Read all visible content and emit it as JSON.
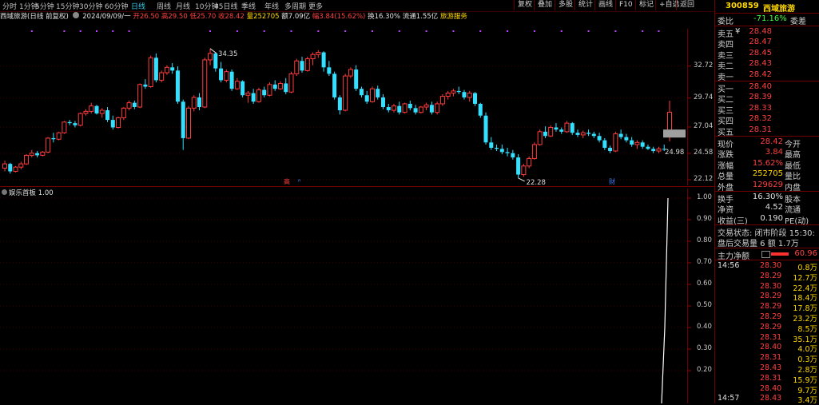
{
  "toolbar": {
    "timeframes": [
      "分时",
      "1分钟",
      "5分钟",
      "15分钟",
      "30分钟",
      "60分钟",
      "日线",
      "周线",
      "月线",
      "10分钟",
      "45日线",
      "季线",
      "年线",
      "多周期",
      "更多"
    ],
    "active_timeframe": "日线",
    "buttons": [
      "复权",
      "叠加",
      "多股",
      "统计",
      "画线",
      "F10",
      "标记",
      "+自选",
      "返回"
    ]
  },
  "header": {
    "stock_title": "西域旅游(日线 前复权)",
    "date": "2024/09/09/一",
    "open_label": "开",
    "open": "26.50",
    "high_label": "高",
    "high": "29.50",
    "low_label": "低",
    "low": "25.70",
    "close_label": "收",
    "close": "28.42",
    "volume_label": "量",
    "volume": "252705",
    "amount_label": "额",
    "amount": "7.09亿",
    "change_label": "幅",
    "change": "3.84(15.62%)",
    "turnover_label": "换",
    "turnover": "16.30%",
    "float_label": "流通",
    "float": "1.55亿",
    "sector": "旅游服务"
  },
  "kline": {
    "y_ticks": [
      "32.72",
      "29.74",
      "27.04",
      "24.58",
      "22.12"
    ],
    "high_marker": "34.35",
    "low_marker": "22.28",
    "last_marker": "24.98",
    "bottom_marks": [
      "高",
      "ᴿ",
      "财"
    ]
  },
  "indicator": {
    "title": "娱乐首板",
    "value": "1.00",
    "y_ticks": [
      "1.00",
      "0.90",
      "0.80",
      "0.70",
      "0.60",
      "0.50",
      "0.40",
      "0.30",
      "0.20"
    ]
  },
  "chart_data": {
    "type": "candlestick",
    "ylim": [
      21.6,
      36.2
    ],
    "candles": [
      [
        23.2,
        23.9,
        22.9,
        23.6
      ],
      [
        23.6,
        23.7,
        22.7,
        22.9
      ],
      [
        22.9,
        23.4,
        22.8,
        23.3
      ],
      [
        23.3,
        23.8,
        23.1,
        23.6
      ],
      [
        23.6,
        24.5,
        23.5,
        24.4
      ],
      [
        24.4,
        24.9,
        24.2,
        24.6
      ],
      [
        24.6,
        24.8,
        24.2,
        24.4
      ],
      [
        24.4,
        24.8,
        24.3,
        24.7
      ],
      [
        24.7,
        26.1,
        24.6,
        26.0
      ],
      [
        26.0,
        26.5,
        25.6,
        25.9
      ],
      [
        25.9,
        26.6,
        25.8,
        26.5
      ],
      [
        26.5,
        27.6,
        26.4,
        27.5
      ],
      [
        27.5,
        27.7,
        27.2,
        27.4
      ],
      [
        27.4,
        27.6,
        27.0,
        27.2
      ],
      [
        27.2,
        28.4,
        27.1,
        28.3
      ],
      [
        28.3,
        28.7,
        28.1,
        28.5
      ],
      [
        28.5,
        29.3,
        28.3,
        29.0
      ],
      [
        29.0,
        29.1,
        28.2,
        28.3
      ],
      [
        28.3,
        28.8,
        27.9,
        28.6
      ],
      [
        28.6,
        28.9,
        27.5,
        27.7
      ],
      [
        27.7,
        28.1,
        26.8,
        27.0
      ],
      [
        27.0,
        28.0,
        26.9,
        27.9
      ],
      [
        27.9,
        28.9,
        27.7,
        28.8
      ],
      [
        28.8,
        29.5,
        28.6,
        29.3
      ],
      [
        29.3,
        29.5,
        28.7,
        28.9
      ],
      [
        28.9,
        31.1,
        28.8,
        31.0
      ],
      [
        31.0,
        31.5,
        30.6,
        30.8
      ],
      [
        30.8,
        33.7,
        30.7,
        33.5
      ],
      [
        33.5,
        33.9,
        31.2,
        31.4
      ],
      [
        31.4,
        32.3,
        31.2,
        32.1
      ],
      [
        32.1,
        32.8,
        31.9,
        32.6
      ],
      [
        32.6,
        33.0,
        32.0,
        32.3
      ],
      [
        32.3,
        32.7,
        29.2,
        29.4
      ],
      [
        29.4,
        29.6,
        24.9,
        26.0
      ],
      [
        26.0,
        29.0,
        25.9,
        28.8
      ],
      [
        28.8,
        30.0,
        28.5,
        29.8
      ],
      [
        29.8,
        30.2,
        28.6,
        28.9
      ],
      [
        28.9,
        33.5,
        28.8,
        33.3
      ],
      [
        33.3,
        34.35,
        32.8,
        33.9
      ],
      [
        33.9,
        34.0,
        32.2,
        32.5
      ],
      [
        32.5,
        33.1,
        31.2,
        31.4
      ],
      [
        31.4,
        32.4,
        31.2,
        32.2
      ],
      [
        32.2,
        32.4,
        30.4,
        30.6
      ],
      [
        30.6,
        31.6,
        30.5,
        31.3
      ],
      [
        31.3,
        31.4,
        29.8,
        30.0
      ],
      [
        30.0,
        30.4,
        29.3,
        30.2
      ],
      [
        30.2,
        30.6,
        29.2,
        29.4
      ],
      [
        29.4,
        30.7,
        29.3,
        30.5
      ],
      [
        30.5,
        30.8,
        29.8,
        30.0
      ],
      [
        30.0,
        31.2,
        29.9,
        31.0
      ],
      [
        31.0,
        31.4,
        30.4,
        30.6
      ],
      [
        30.6,
        31.3,
        30.5,
        31.1
      ],
      [
        31.1,
        31.6,
        30.1,
        30.3
      ],
      [
        30.3,
        32.2,
        30.2,
        32.0
      ],
      [
        32.0,
        33.4,
        31.8,
        33.2
      ],
      [
        33.2,
        33.6,
        32.1,
        32.3
      ],
      [
        32.3,
        33.6,
        32.2,
        33.4
      ],
      [
        33.4,
        34.0,
        32.8,
        33.8
      ],
      [
        33.8,
        34.2,
        33.5,
        34.0
      ],
      [
        34.0,
        34.1,
        32.2,
        32.6
      ],
      [
        32.6,
        33.2,
        31.8,
        32.0
      ],
      [
        32.0,
        32.2,
        29.6,
        29.8
      ],
      [
        29.8,
        30.0,
        28.2,
        28.6
      ],
      [
        28.6,
        32.0,
        28.5,
        31.8
      ],
      [
        31.8,
        32.6,
        31.6,
        32.4
      ],
      [
        32.4,
        32.8,
        30.4,
        30.6
      ],
      [
        30.6,
        30.8,
        29.8,
        30.0
      ],
      [
        30.0,
        30.4,
        29.2,
        29.4
      ],
      [
        29.4,
        30.8,
        29.3,
        30.6
      ],
      [
        30.6,
        30.9,
        29.6,
        29.8
      ],
      [
        29.8,
        30.1,
        28.7,
        28.9
      ],
      [
        28.9,
        29.2,
        28.4,
        28.6
      ],
      [
        28.6,
        29.2,
        28.4,
        29.0
      ],
      [
        29.0,
        29.4,
        28.2,
        28.4
      ],
      [
        28.4,
        29.3,
        28.3,
        29.2
      ],
      [
        29.2,
        29.5,
        28.6,
        28.8
      ],
      [
        28.8,
        29.1,
        28.2,
        28.4
      ],
      [
        28.4,
        29.0,
        28.3,
        28.9
      ],
      [
        28.9,
        29.3,
        28.6,
        29.1
      ],
      [
        29.1,
        29.4,
        28.2,
        28.4
      ],
      [
        28.4,
        29.4,
        28.2,
        29.2
      ],
      [
        29.2,
        30.1,
        29.0,
        29.9
      ],
      [
        29.9,
        30.4,
        29.6,
        30.2
      ],
      [
        30.2,
        30.6,
        29.9,
        30.4
      ],
      [
        30.4,
        30.8,
        30.1,
        30.3
      ],
      [
        30.3,
        30.5,
        29.6,
        29.8
      ],
      [
        29.8,
        30.4,
        29.4,
        30.2
      ],
      [
        30.2,
        30.3,
        29.0,
        29.2
      ],
      [
        29.2,
        29.3,
        27.9,
        28.1
      ],
      [
        28.1,
        28.4,
        25.4,
        25.6
      ],
      [
        25.6,
        26.1,
        24.9,
        25.1
      ],
      [
        25.1,
        25.4,
        24.8,
        25.0
      ],
      [
        25.0,
        25.4,
        24.5,
        24.7
      ],
      [
        24.7,
        25.1,
        24.3,
        24.6
      ],
      [
        24.6,
        24.9,
        24.0,
        24.2
      ],
      [
        24.2,
        24.5,
        22.28,
        22.6
      ],
      [
        22.6,
        23.6,
        22.4,
        23.4
      ],
      [
        23.4,
        24.3,
        23.2,
        24.1
      ],
      [
        24.1,
        25.6,
        24.0,
        25.4
      ],
      [
        25.4,
        26.8,
        25.3,
        26.6
      ],
      [
        26.6,
        27.1,
        26.0,
        26.2
      ],
      [
        26.2,
        27.2,
        26.1,
        27.0
      ],
      [
        27.0,
        27.4,
        26.6,
        26.8
      ],
      [
        26.8,
        27.0,
        26.4,
        26.6
      ],
      [
        26.6,
        27.6,
        26.5,
        27.4
      ],
      [
        27.4,
        27.5,
        26.3,
        26.5
      ],
      [
        26.5,
        26.8,
        26.1,
        26.3
      ],
      [
        26.3,
        26.7,
        26.0,
        26.5
      ],
      [
        26.5,
        26.8,
        26.2,
        26.4
      ],
      [
        26.4,
        26.6,
        26.0,
        26.2
      ],
      [
        26.2,
        26.5,
        25.6,
        25.8
      ],
      [
        25.8,
        26.0,
        24.9,
        25.1
      ],
      [
        25.1,
        25.3,
        24.6,
        24.8
      ],
      [
        24.8,
        26.6,
        24.7,
        26.4
      ],
      [
        26.4,
        26.8,
        25.9,
        26.1
      ],
      [
        26.1,
        26.4,
        25.6,
        25.8
      ],
      [
        25.8,
        26.1,
        25.2,
        25.4
      ],
      [
        25.4,
        25.8,
        25.0,
        25.6
      ],
      [
        25.6,
        25.8,
        25.0,
        25.2
      ],
      [
        25.2,
        25.4,
        24.9,
        25.0
      ],
      [
        25.0,
        25.2,
        24.6,
        24.8
      ],
      [
        24.8,
        25.2,
        24.6,
        25.0
      ],
      [
        25.0,
        25.4,
        24.8,
        24.98
      ],
      [
        26.5,
        29.5,
        25.7,
        28.42
      ]
    ]
  },
  "right": {
    "code": "300859",
    "name": "西域旅游",
    "webi_label": "委比",
    "webi": "-71.16%",
    "weicha_label": "委差",
    "sells": [
      {
        "label": "卖五",
        "flag": "¥",
        "price": "28.48"
      },
      {
        "label": "卖四",
        "flag": "",
        "price": "28.47"
      },
      {
        "label": "卖三",
        "flag": "",
        "price": "28.45"
      },
      {
        "label": "卖二",
        "flag": "",
        "price": "28.43"
      },
      {
        "label": "卖一",
        "flag": "",
        "price": "28.42"
      }
    ],
    "buys": [
      {
        "label": "买一",
        "price": "28.40"
      },
      {
        "label": "买二",
        "price": "28.39"
      },
      {
        "label": "买三",
        "price": "28.33"
      },
      {
        "label": "买四",
        "price": "28.32"
      },
      {
        "label": "买五",
        "price": "28.31"
      }
    ],
    "quote": [
      {
        "l": "现价",
        "v": "28.42",
        "r": "今开"
      },
      {
        "l": "涨跌",
        "v": "3.84",
        "r": "最高"
      },
      {
        "l": "涨幅",
        "v": "15.62%",
        "r": "最低"
      },
      {
        "l": "总量",
        "v": "252705",
        "r": "量比"
      },
      {
        "l": "外盘",
        "v": "129629",
        "r": "内盘"
      }
    ],
    "stats": [
      {
        "l": "换手",
        "v": "16.30%",
        "r": "股本"
      },
      {
        "l": "净资",
        "v": "4.52",
        "r": "流通"
      },
      {
        "l": "收益(三)",
        "v": "0.190",
        "r": "PE(动)"
      }
    ],
    "trade_state": "交易状态: 闭市阶段 15:30:",
    "after_trade": "盘后交易量 6 额 1.7万",
    "main_flow_label": "主力净额",
    "main_flow": "60.96",
    "ticks": [
      {
        "t": "14:56",
        "p": "28.30",
        "v": "0.8万"
      },
      {
        "t": "",
        "p": "28.29",
        "v": "12.7万"
      },
      {
        "t": "",
        "p": "28.30",
        "v": "22.4万"
      },
      {
        "t": "",
        "p": "28.29",
        "v": "18.4万"
      },
      {
        "t": "",
        "p": "28.29",
        "v": "17.8万"
      },
      {
        "t": "",
        "p": "28.29",
        "v": "23.2万"
      },
      {
        "t": "",
        "p": "28.29",
        "v": "8.5万"
      },
      {
        "t": "",
        "p": "28.31",
        "v": "35.1万"
      },
      {
        "t": "",
        "p": "28.40",
        "v": "4.0万"
      },
      {
        "t": "",
        "p": "28.31",
        "v": "0.3万"
      },
      {
        "t": "",
        "p": "28.43",
        "v": "2.8万"
      },
      {
        "t": "",
        "p": "28.31",
        "v": "15.9万"
      },
      {
        "t": "",
        "p": "28.40",
        "v": "9.7万"
      },
      {
        "t": "14:57",
        "p": "28.43",
        "v": "3.4万"
      }
    ]
  }
}
